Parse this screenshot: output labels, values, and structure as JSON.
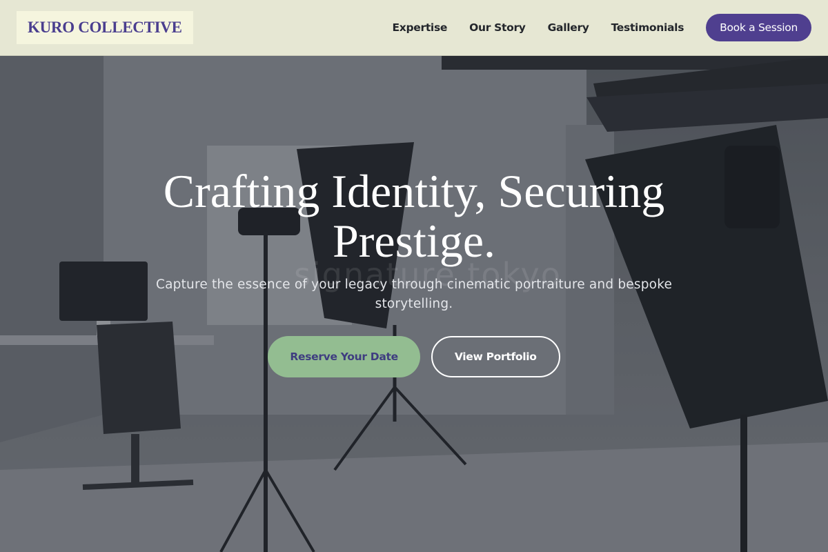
{
  "brand": {
    "name": "KURO COLLECTIVE"
  },
  "nav": {
    "links": [
      {
        "label": "Expertise"
      },
      {
        "label": "Our Story"
      },
      {
        "label": "Gallery"
      },
      {
        "label": "Testimonials"
      }
    ],
    "cta_label": "Book a Session"
  },
  "hero": {
    "title": "Crafting Identity, Securing Prestige.",
    "subtitle": "Capture the essence of your legacy through cinematic portraiture and bespoke storytelling.",
    "watermark": "signature tokyo",
    "primary_action": "Reserve Your Date",
    "secondary_action": "View Portfolio",
    "background_image": "photography-studio-with-softbox-lights"
  },
  "colors": {
    "header_background": "#e6e7d3",
    "brand_text": "#4a3e8f",
    "cta_background": "#4f3f8f",
    "primary_button_background": "#93bd91",
    "primary_button_text": "#3f3d80",
    "hero_text": "#ffffff"
  }
}
